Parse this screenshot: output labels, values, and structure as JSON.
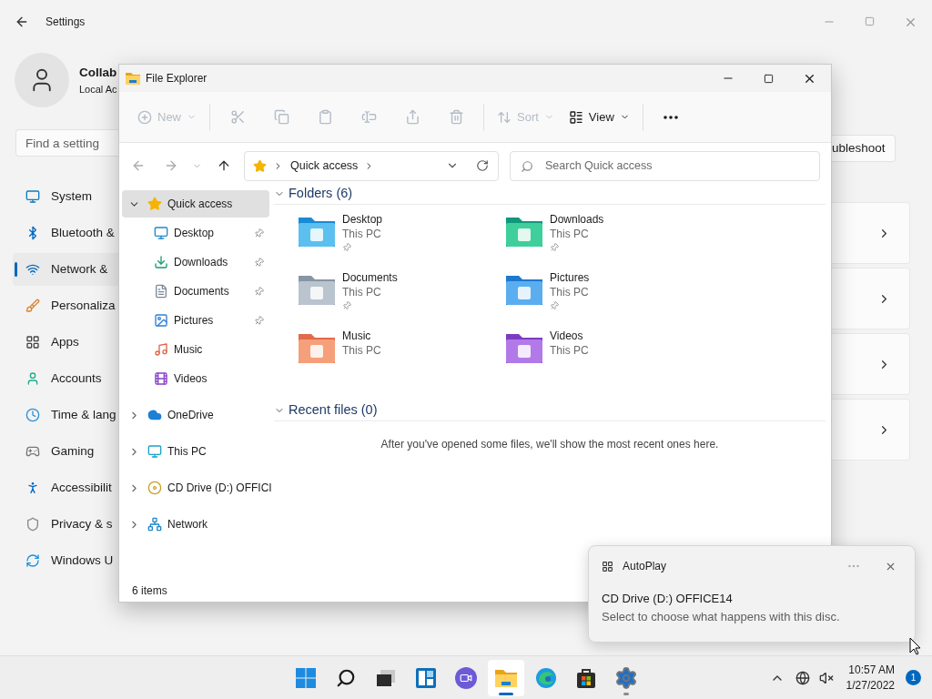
{
  "settings": {
    "title": "Settings",
    "profile": {
      "name": "Collab",
      "account": "Local Ac"
    },
    "search": {
      "placeholder": "Find a setting"
    },
    "nav": [
      {
        "label": "System",
        "selected": false
      },
      {
        "label": "Bluetooth &",
        "selected": false
      },
      {
        "label": "Network &",
        "selected": true
      },
      {
        "label": "Personaliza",
        "selected": false
      },
      {
        "label": "Apps",
        "selected": false
      },
      {
        "label": "Accounts",
        "selected": false
      },
      {
        "label": "Time & lang",
        "selected": false
      },
      {
        "label": "Gaming",
        "selected": false
      },
      {
        "label": "Accessibilit",
        "selected": false
      },
      {
        "label": "Privacy & s",
        "selected": false
      },
      {
        "label": "Windows U",
        "selected": false
      }
    ],
    "troubleshoot": "ubleshoot"
  },
  "explorer": {
    "title": "File Explorer",
    "toolbar": [
      {
        "kind": "button",
        "label": "New",
        "disabled": true
      },
      {
        "kind": "icon",
        "disabled": true
      },
      {
        "kind": "icon",
        "disabled": true
      },
      {
        "kind": "icon",
        "disabled": true
      },
      {
        "kind": "icon",
        "disabled": true
      },
      {
        "kind": "icon",
        "disabled": true
      },
      {
        "kind": "icon",
        "disabled": true
      },
      {
        "kind": "button",
        "label": "Sort",
        "disabled": true
      },
      {
        "kind": "button",
        "label": "View",
        "disabled": false
      },
      {
        "kind": "icon",
        "disabled": false
      }
    ],
    "address": "Quick access",
    "search": {
      "placeholder": "Search Quick access"
    },
    "tree": [
      {
        "label": "Quick access",
        "expanded": true,
        "selected": true,
        "children": [
          {
            "label": "Desktop",
            "pinned": true,
            "selected": false
          },
          {
            "label": "Downloads",
            "pinned": true,
            "selected": false
          },
          {
            "label": "Documents",
            "pinned": true,
            "selected": false
          },
          {
            "label": "Pictures",
            "pinned": true,
            "selected": false
          },
          {
            "label": "Music",
            "pinned": false,
            "selected": false
          },
          {
            "label": "Videos",
            "pinned": false,
            "selected": false
          }
        ]
      },
      {
        "label": "OneDrive",
        "expanded": false,
        "selected": false
      },
      {
        "label": "This PC",
        "expanded": false,
        "selected": false
      },
      {
        "label": "CD Drive (D:) OFFICI",
        "expanded": false,
        "selected": false
      },
      {
        "label": "Network",
        "expanded": false,
        "selected": false
      }
    ],
    "folders": {
      "heading": "Folders (6)",
      "expanded": true,
      "items": [
        {
          "name": "Desktop",
          "location": "This PC",
          "pinned": true
        },
        {
          "name": "Downloads",
          "location": "This PC",
          "pinned": true
        },
        {
          "name": "Documents",
          "location": "This PC",
          "pinned": true
        },
        {
          "name": "Pictures",
          "location": "This PC",
          "pinned": true
        },
        {
          "name": "Music",
          "location": "This PC",
          "pinned": false
        },
        {
          "name": "Videos",
          "location": "This PC",
          "pinned": false
        }
      ]
    },
    "recent": {
      "heading": "Recent files (0)",
      "expanded": true,
      "message": "After you've opened some files, we'll show the most recent ones here."
    },
    "status": "6 items"
  },
  "toast": {
    "app": "AutoPlay",
    "title": "CD Drive (D:) OFFICE14",
    "body": "Select to choose what happens with this disc."
  },
  "taskbar": {
    "apps": [
      {
        "running": false,
        "selected": false
      },
      {
        "running": false,
        "selected": false
      },
      {
        "running": false,
        "selected": false
      },
      {
        "running": false,
        "selected": false
      },
      {
        "running": false,
        "selected": false
      },
      {
        "running": true,
        "selected": true
      },
      {
        "running": false,
        "selected": false
      },
      {
        "running": false,
        "selected": false
      },
      {
        "running": true,
        "selected": false
      }
    ],
    "time": "10:57 AM",
    "date": "1/27/2022",
    "badge": "1"
  }
}
